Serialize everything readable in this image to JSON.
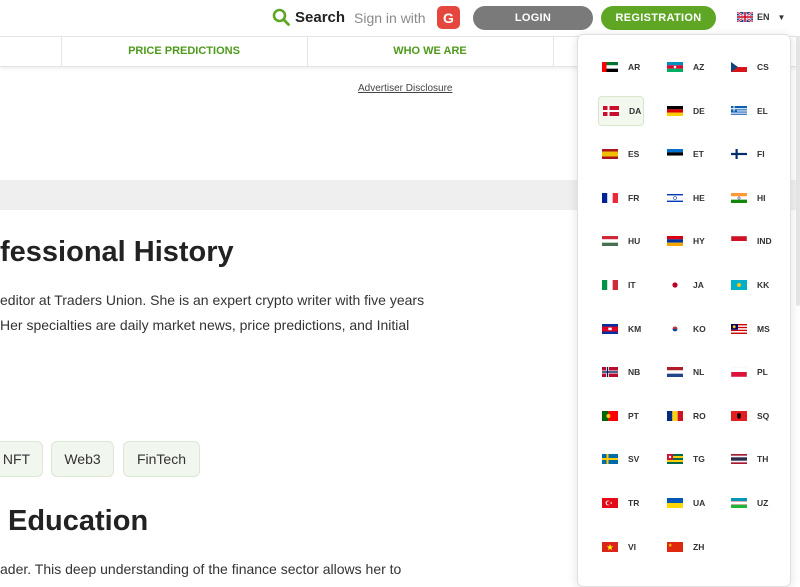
{
  "header": {
    "search_label": "Search",
    "signin_label": "Sign in with",
    "google_letter": "G",
    "login_label": "LOGIN",
    "registration_label": "REGISTRATION",
    "current_lang": "EN"
  },
  "nav": {
    "items": [
      "PRICE PREDICTIONS",
      "WHO WE ARE"
    ]
  },
  "disclosure": "Advertiser Disclosure",
  "article": {
    "heading1": "fessional History",
    "para1_line1": "editor at Traders Union. She is an expert crypto writer with five years",
    "para1_line2": "Her specialties are daily market news, price predictions, and Initial",
    "tags": [
      "NFT",
      "Web3",
      "FinTech"
    ],
    "heading2": "Education",
    "para2_line1": "ader. This deep understanding of the finance sector allows her to"
  },
  "languages": [
    {
      "code": "AR",
      "flag": "ae"
    },
    {
      "code": "AZ",
      "flag": "az"
    },
    {
      "code": "CS",
      "flag": "cz"
    },
    {
      "code": "DA",
      "flag": "dk"
    },
    {
      "code": "DE",
      "flag": "de"
    },
    {
      "code": "EL",
      "flag": "gr"
    },
    {
      "code": "ES",
      "flag": "es"
    },
    {
      "code": "ET",
      "flag": "ee"
    },
    {
      "code": "FI",
      "flag": "fi"
    },
    {
      "code": "FR",
      "flag": "fr"
    },
    {
      "code": "HE",
      "flag": "il"
    },
    {
      "code": "HI",
      "flag": "in"
    },
    {
      "code": "HU",
      "flag": "hu"
    },
    {
      "code": "HY",
      "flag": "am"
    },
    {
      "code": "IND",
      "flag": "id"
    },
    {
      "code": "IT",
      "flag": "it"
    },
    {
      "code": "JA",
      "flag": "jp"
    },
    {
      "code": "KK",
      "flag": "kz"
    },
    {
      "code": "KM",
      "flag": "kh"
    },
    {
      "code": "KO",
      "flag": "kr"
    },
    {
      "code": "MS",
      "flag": "my"
    },
    {
      "code": "NB",
      "flag": "no"
    },
    {
      "code": "NL",
      "flag": "nl"
    },
    {
      "code": "PL",
      "flag": "pl"
    },
    {
      "code": "PT",
      "flag": "pt"
    },
    {
      "code": "RO",
      "flag": "ro"
    },
    {
      "code": "SQ",
      "flag": "al"
    },
    {
      "code": "SV",
      "flag": "se"
    },
    {
      "code": "TG",
      "flag": "tg"
    },
    {
      "code": "TH",
      "flag": "th"
    },
    {
      "code": "TR",
      "flag": "tr"
    },
    {
      "code": "UA",
      "flag": "ua"
    },
    {
      "code": "UZ",
      "flag": "uz"
    },
    {
      "code": "VI",
      "flag": "vn"
    },
    {
      "code": "ZH",
      "flag": "cn"
    }
  ],
  "active_language": "DA",
  "colors": {
    "brand_green": "#5fa625",
    "nav_green": "#4e9a1c",
    "login_gray": "#7a7a7a",
    "google_red": "#e5473e"
  }
}
